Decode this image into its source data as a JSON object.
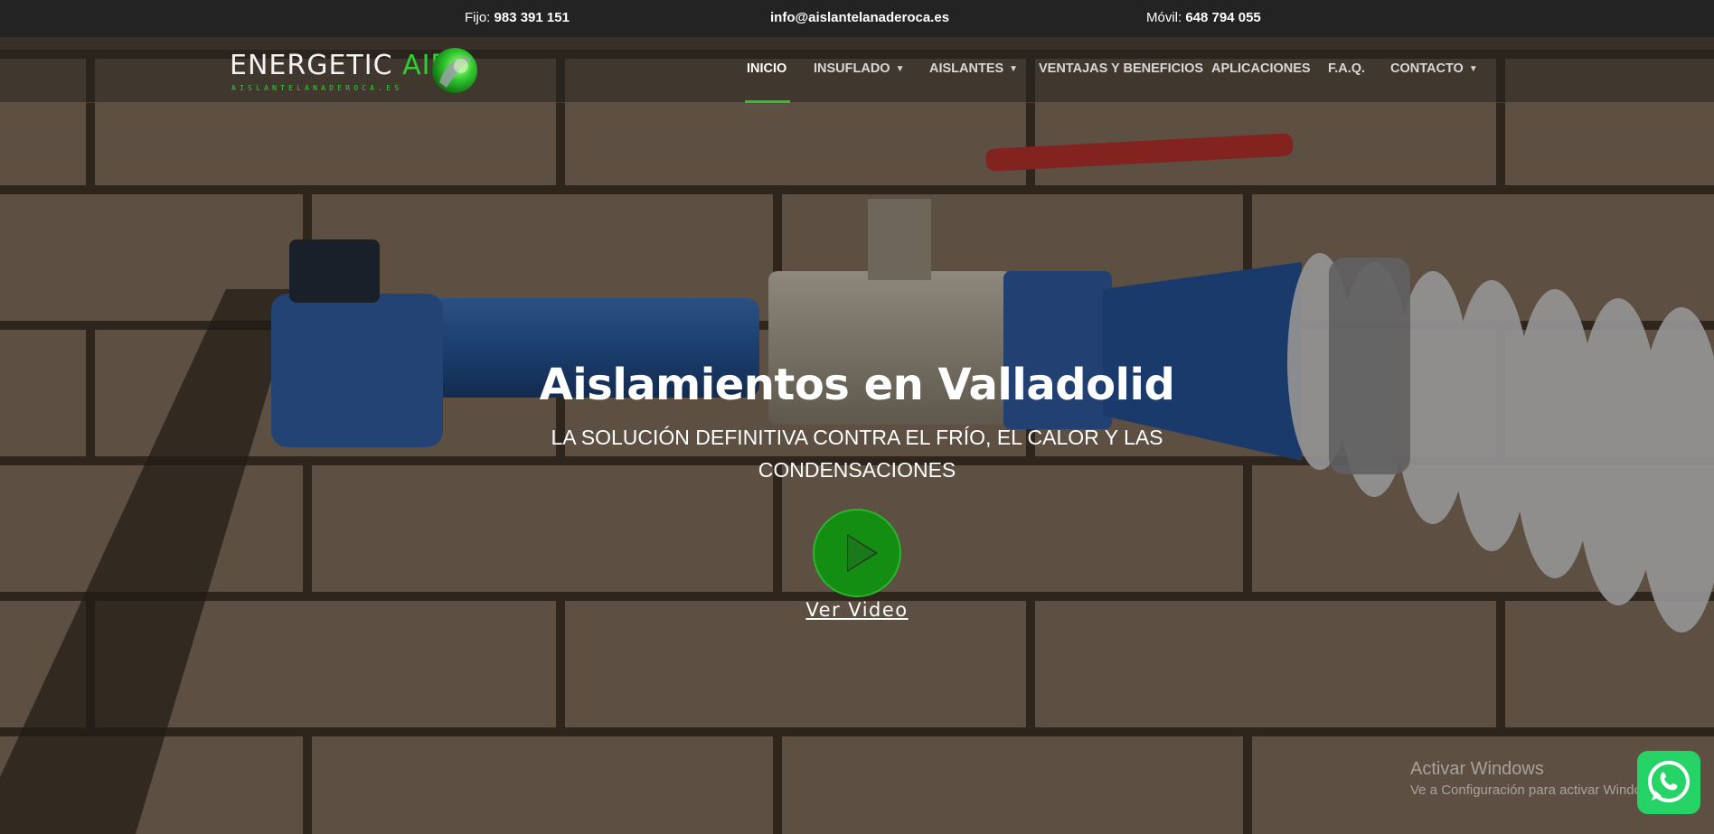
{
  "topbar": {
    "fijo_label": "Fijo:",
    "fijo_number": "983 391 151",
    "email": "info@aislantelanaderoca.es",
    "movil_label": "Móvil:",
    "movil_number": "648 794 055"
  },
  "logo": {
    "word1": "ENERGETIC ",
    "word2": "AIR",
    "domain": "AISLANTELANADEROCA.ES"
  },
  "nav": {
    "items": [
      {
        "label": "INICIO",
        "active": true
      },
      {
        "label": "INSUFLADO",
        "caret": "chevron-down-icon"
      },
      {
        "label": "AISLANTES",
        "caret": "chevron-down-icon"
      },
      {
        "label": "VENTAJAS Y BENEFICIOS"
      },
      {
        "label": "APLICACIONES"
      },
      {
        "label": "F.A.Q."
      },
      {
        "label": "CONTACTO",
        "caret": "chevron-down-icon"
      }
    ]
  },
  "hero": {
    "title": "Aislamientos en Valladolid",
    "subtitle": "LA SOLUCIÓN DEFINITIVA CONTRA EL FRÍO, EL CALOR Y LAS CONDENSACIONES",
    "video_link": "Ver Video",
    "play_icon": "play-icon"
  },
  "watermark": {
    "line1": "Activar Windows",
    "line2": "Ve a Configuración para activar Windows."
  },
  "colors": {
    "accent_green": "#2fbf2f",
    "play_green": "#138e13",
    "whatsapp_green": "#25d366",
    "topbar_bg": "#232323"
  }
}
